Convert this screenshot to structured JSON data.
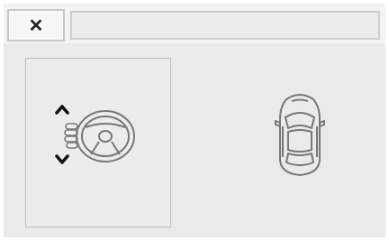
{
  "header": {
    "close_label": "✕",
    "message": ""
  },
  "controls": {
    "steering_panel_icon": "steering-wheel-adjust-icon",
    "vehicle_icon": "car-top-view-icon"
  },
  "colors": {
    "screen_background": "#eaeaea",
    "border": "#bdbdbd",
    "icon_stroke": "#777777",
    "icon_dark": "#111111"
  }
}
